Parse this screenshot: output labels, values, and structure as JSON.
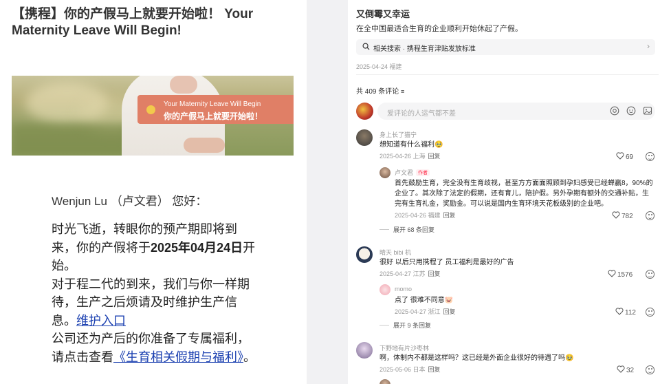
{
  "email": {
    "title": "【携程】你的产假马上就要开始啦！ Your Maternity Leave Will Begin!",
    "banner_en": "Your Maternity Leave Will Begin",
    "banner_zh": "你的产假马上就要开始啦！",
    "greeting": "Wenjun Lu （卢文君） 您好：",
    "p1_a": "时光飞逝，转眼你的预产期即将到来，你的产假将于",
    "p1_date": "2025年04月24日",
    "p1_b": "开始。",
    "p2": "对于程二代的到来，我们与你一样期待，生产之后烦请及时维护生产信息。",
    "p2_link": "维护入口",
    "p3": "公司还为产后的你准备了专属福利，请点击查看",
    "p3_link": "《生育相关假期与福利》",
    "p3_end": "。"
  },
  "post": {
    "title": "又倒霉又幸运",
    "body": "在全中国最适合生育的企业顺利开始休起了产假。",
    "search_label": "相关搜索 · 携程生育津贴发放标准",
    "meta": "2025-04-24 福建",
    "comment_count": "共 409 条评论"
  },
  "comment_input": {
    "placeholder": "爱评论的人运气都不差"
  },
  "comments": [
    {
      "name": "身上长了猫宁",
      "text": "想知道有什么福利🥹",
      "meta": "2025-04-26 上海",
      "reply": "回复",
      "likes": "69"
    },
    {
      "name": "卢文君",
      "tag": "作者",
      "text": "首先鼓励生育，完全没有生育歧视，甚至方方面面照顾到孕妇感受已经蝉赢8，90%的企业了。其次除了法定的假期，还有育儿，陪护假。另外孕期有额外的交通补贴，生完有生育礼金，奖励金。可以说是国内生育环境天花板级别的企业吧。",
      "meta": "2025-04-26 福建",
      "reply": "回复",
      "likes": "782"
    },
    {
      "expand": "展开 68 条回复"
    },
    {
      "name": "晴天 bibi 机",
      "text": "很好 以后只用携程了 员工福利是最好的广告",
      "meta": "2025-04-27 江苏",
      "reply": "回复",
      "likes": "1576"
    },
    {
      "name": "momo",
      "text": "点了 很难不同意🐷",
      "meta": "2025-04-27 浙江",
      "reply": "回复",
      "likes": "112"
    },
    {
      "expand": "展开 9 条回复"
    },
    {
      "name": "下野地有片沙枣林",
      "text": "啊，体制内不都是这样吗？这已经是外面企业很好的待遇了吗🥹",
      "meta": "2025-05-06 日本",
      "reply": "回复",
      "likes": "32"
    }
  ]
}
